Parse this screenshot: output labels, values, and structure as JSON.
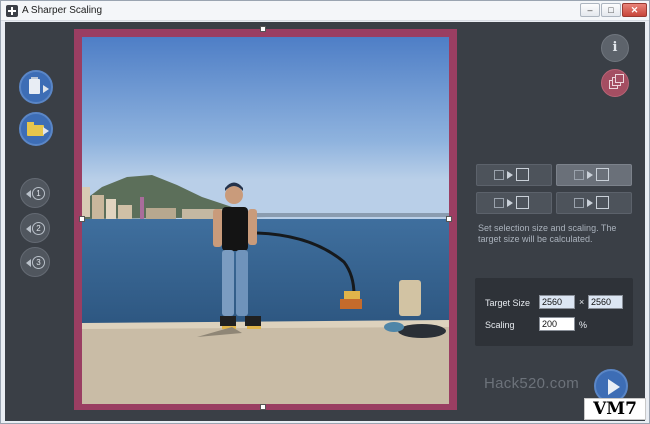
{
  "window": {
    "title": "A Sharper Scaling",
    "controls": {
      "minimize": "–",
      "maximize": "□",
      "close": "✕"
    }
  },
  "left_toolbar": {
    "buttons": [
      {
        "name": "paste-from-clipboard",
        "icon": "clipboard-icon"
      },
      {
        "name": "open-file",
        "icon": "folder-icon"
      },
      {
        "name": "preset-1",
        "label": "1"
      },
      {
        "name": "preset-2",
        "label": "2"
      },
      {
        "name": "preset-3",
        "label": "3"
      }
    ]
  },
  "right_panel": {
    "info_label": "i",
    "mode_buttons": [
      {
        "name": "mode-fit-width",
        "active": false
      },
      {
        "name": "mode-fit-box",
        "active": true
      },
      {
        "name": "mode-fit-height",
        "active": false
      },
      {
        "name": "mode-fill-height",
        "active": false
      }
    ],
    "help_text": "Set selection size and scaling. The target size will be calculated.",
    "target_size_label": "Target Size",
    "target_width": "2560",
    "times": "×",
    "target_height": "2560",
    "scaling_label": "Scaling",
    "scaling_value": "200",
    "percent": "%"
  },
  "watermark": "Hack520.com",
  "badge": "VM7",
  "colors": {
    "background": "#3a3f46",
    "frame": "#9a3e62",
    "accent_blue": "#3d6db5",
    "batch_accent": "#a44e62"
  }
}
